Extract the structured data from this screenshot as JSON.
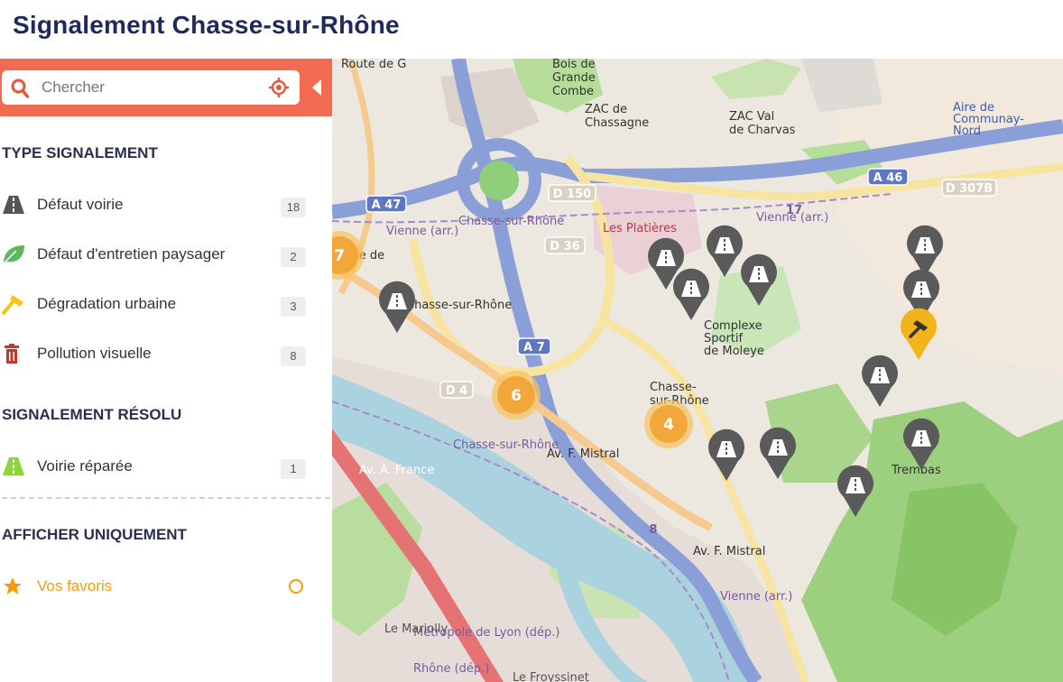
{
  "page": {
    "title": "Signalement Chasse-sur-Rhône"
  },
  "search": {
    "placeholder": "Chercher"
  },
  "sections": {
    "type": "TYPE SIGNALEMENT",
    "resolved": "SIGNALEMENT RÉSOLU",
    "filter": "AFFICHER UNIQUEMENT"
  },
  "types": [
    {
      "label": "Défaut voirie",
      "count": "18",
      "icon": "road-icon",
      "color": "#555555"
    },
    {
      "label": "Défaut d'entretien paysager",
      "count": "2",
      "icon": "leaf-icon",
      "color": "#5cb85c"
    },
    {
      "label": "Dégradation urbaine",
      "count": "3",
      "icon": "hammer-icon",
      "color": "#f5c518"
    },
    {
      "label": "Pollution visuelle",
      "count": "8",
      "icon": "trash-icon",
      "color": "#c0392b"
    }
  ],
  "resolved": [
    {
      "label": "Voirie réparée",
      "count": "1",
      "icon": "road-icon",
      "color": "#8cd63c"
    }
  ],
  "filters": [
    {
      "label": "Vos favoris",
      "icon": "star-icon",
      "color": "#f39c12"
    }
  ],
  "map": {
    "roads": [
      "A 47",
      "A 46",
      "A 7",
      "D 150",
      "D 36",
      "D 4",
      "D 307B",
      "17",
      "8"
    ],
    "labels": [
      "Bois de Grande Combe",
      "ZAC de Chassagne",
      "ZAC Val de Charvas",
      "Aire de Communay-Nord",
      "Les Platières",
      "Vienne (arr.)",
      "Chasse-sur-Rhône",
      "Complexe Sportif de Moleye",
      "Chasse-sur-Rhône",
      "Trembas",
      "Av. F. Mistral",
      "Av. A. France",
      "Av. F. Mistral",
      "Métropole de Lyon (dép.)",
      "Rhône (dép.)",
      "Le Mariolly",
      "Le Froyssinet",
      "Route de G",
      "Vienne (arr.)",
      "Vienne (arr.)",
      "Chasse-sur-Rhône",
      "Chasse-sur-Rhône",
      "Route de"
    ],
    "clusters": [
      "6",
      "4",
      "7"
    ]
  }
}
